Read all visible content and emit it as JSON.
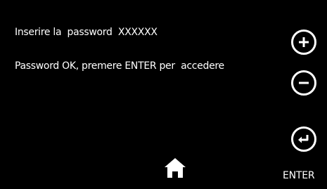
{
  "messages": {
    "password_prompt": "Inserire la  password  XXXXXX",
    "password_ok": "Password OK, premere ENTER per  accedere"
  },
  "controls": {
    "plus_icon": "plus-icon",
    "minus_icon": "minus-icon",
    "enter_icon": "enter-return-icon",
    "enter_label": "ENTER",
    "home_icon": "home-icon"
  },
  "colors": {
    "background": "#000000",
    "foreground": "#ffffff"
  }
}
